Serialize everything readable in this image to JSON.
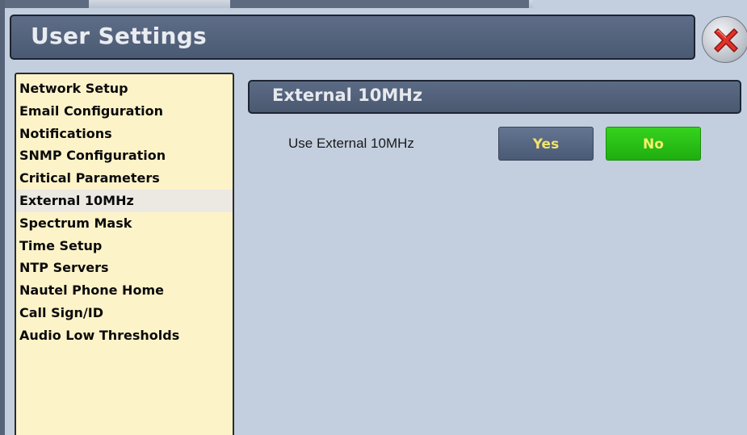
{
  "window": {
    "title": "User Settings"
  },
  "sidebar": {
    "items": [
      {
        "label": "Network Setup"
      },
      {
        "label": "Email Configuration"
      },
      {
        "label": "Notifications"
      },
      {
        "label": "SNMP Configuration"
      },
      {
        "label": "Critical Parameters"
      },
      {
        "label": "External 10MHz",
        "selected": true
      },
      {
        "label": "Spectrum Mask"
      },
      {
        "label": "Time Setup"
      },
      {
        "label": "NTP Servers"
      },
      {
        "label": "Nautel Phone Home"
      },
      {
        "label": "Call Sign/ID"
      },
      {
        "label": "Audio Low Thresholds"
      }
    ]
  },
  "main": {
    "section_title": "External 10MHz",
    "setting": {
      "label": "Use External 10MHz",
      "yes_label": "Yes",
      "no_label": "No",
      "selected": "No"
    }
  },
  "icons": {
    "close": "close-icon"
  },
  "colors": {
    "panel_background": "#c3cfdf",
    "header_background": "#4f5d77",
    "sidebar_background": "#fdf3c9",
    "selected_button": "#2ac216",
    "unselected_button": "#566783",
    "button_text": "#f2e36b",
    "close_x": "#e0322a"
  }
}
